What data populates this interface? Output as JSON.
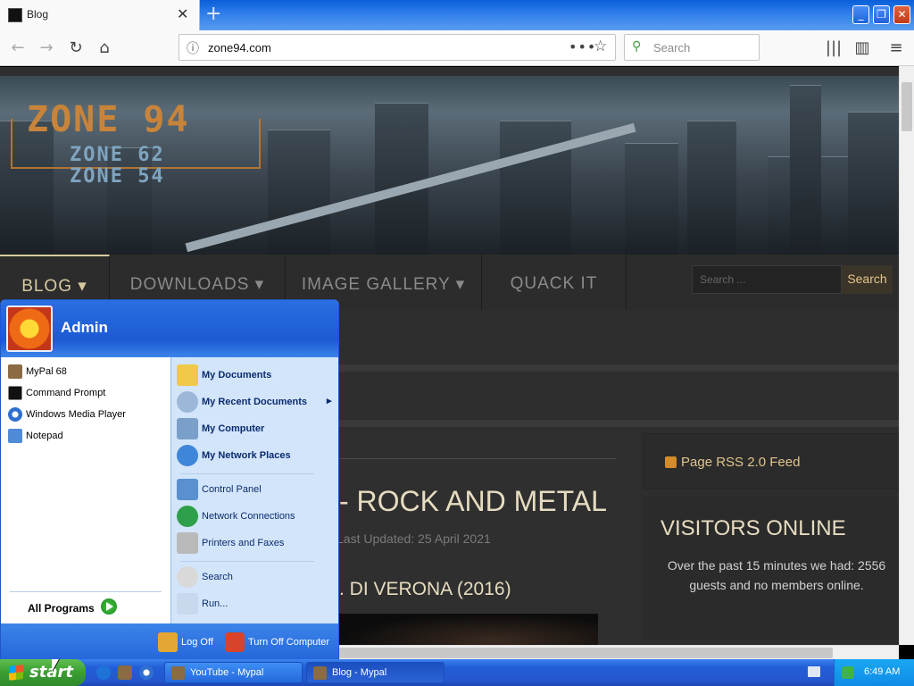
{
  "browser": {
    "tab_title": "Blog",
    "url": "zone94.com",
    "search_placeholder": "Search",
    "new_tab_symbol": "+",
    "close_symbol": "✕",
    "window_buttons": {
      "minimize": "_",
      "restore": "❐",
      "close": "✕"
    },
    "toolbar_icons": [
      "back-icon",
      "forward-icon",
      "reload-icon",
      "home-icon",
      "library-icon",
      "sidebar-icon",
      "menu-icon"
    ]
  },
  "site": {
    "logo": {
      "main": "ZONE 94",
      "line2": "ZONE 62",
      "line3": "ZONE 54"
    },
    "nav": [
      {
        "label": "BLOG ▾"
      },
      {
        "label": "DOWNLOADS ▾"
      },
      {
        "label": "IMAGE GALLERY ▾"
      },
      {
        "label": "QUACK IT"
      }
    ],
    "search_placeholder": "Search ...",
    "search_button": "Search",
    "article": {
      "title": "- ROCK AND METAL",
      "meta": "Last Updated: 25 April 2021",
      "subtitle": ". DI VERONA (2016)"
    },
    "rss": "Page RSS 2.0 Feed",
    "visitors": {
      "heading": "VISITORS ONLINE",
      "text": "Over the past 15 minutes we had: 2556 guests and no members online."
    }
  },
  "start_menu": {
    "user": "Admin",
    "pinned": [
      {
        "label": "MyPal 68",
        "color": "#8a6b43"
      },
      {
        "label": "Command Prompt",
        "color": "#111111"
      },
      {
        "label": "Windows Media Player",
        "color": "#2f6fd1"
      },
      {
        "label": "Notepad",
        "color": "#4f8bd6"
      }
    ],
    "all_programs": "All Programs",
    "places": [
      {
        "label": "My Documents",
        "bold": true,
        "color": "#f0c94a"
      },
      {
        "label": "My Recent Documents",
        "bold": true,
        "color": "#9db7d8",
        "arrow": "▸"
      },
      {
        "label": "My Computer",
        "bold": true,
        "color": "#7aa0c9"
      },
      {
        "label": "My Network Places",
        "bold": true,
        "color": "#3f86d8"
      },
      {
        "label": "Control Panel",
        "bold": false,
        "color": "#5a8fd0"
      },
      {
        "label": "Network Connections",
        "bold": false,
        "color": "#2e9f4a"
      },
      {
        "label": "Printers and Faxes",
        "bold": false,
        "color": "#b9b9b9"
      },
      {
        "label": "Search",
        "bold": false,
        "color": "#d9d9d9"
      },
      {
        "label": "Run...",
        "bold": false,
        "color": "#c9d8ec"
      }
    ],
    "log_off": "Log Off",
    "turn_off": "Turn Off Computer"
  },
  "taskbar": {
    "start_label": "start",
    "tasks": [
      {
        "label": "YouTube - Mypal",
        "active": false
      },
      {
        "label": "Blog - Mypal",
        "active": true
      }
    ],
    "clock": "6:49 AM"
  }
}
